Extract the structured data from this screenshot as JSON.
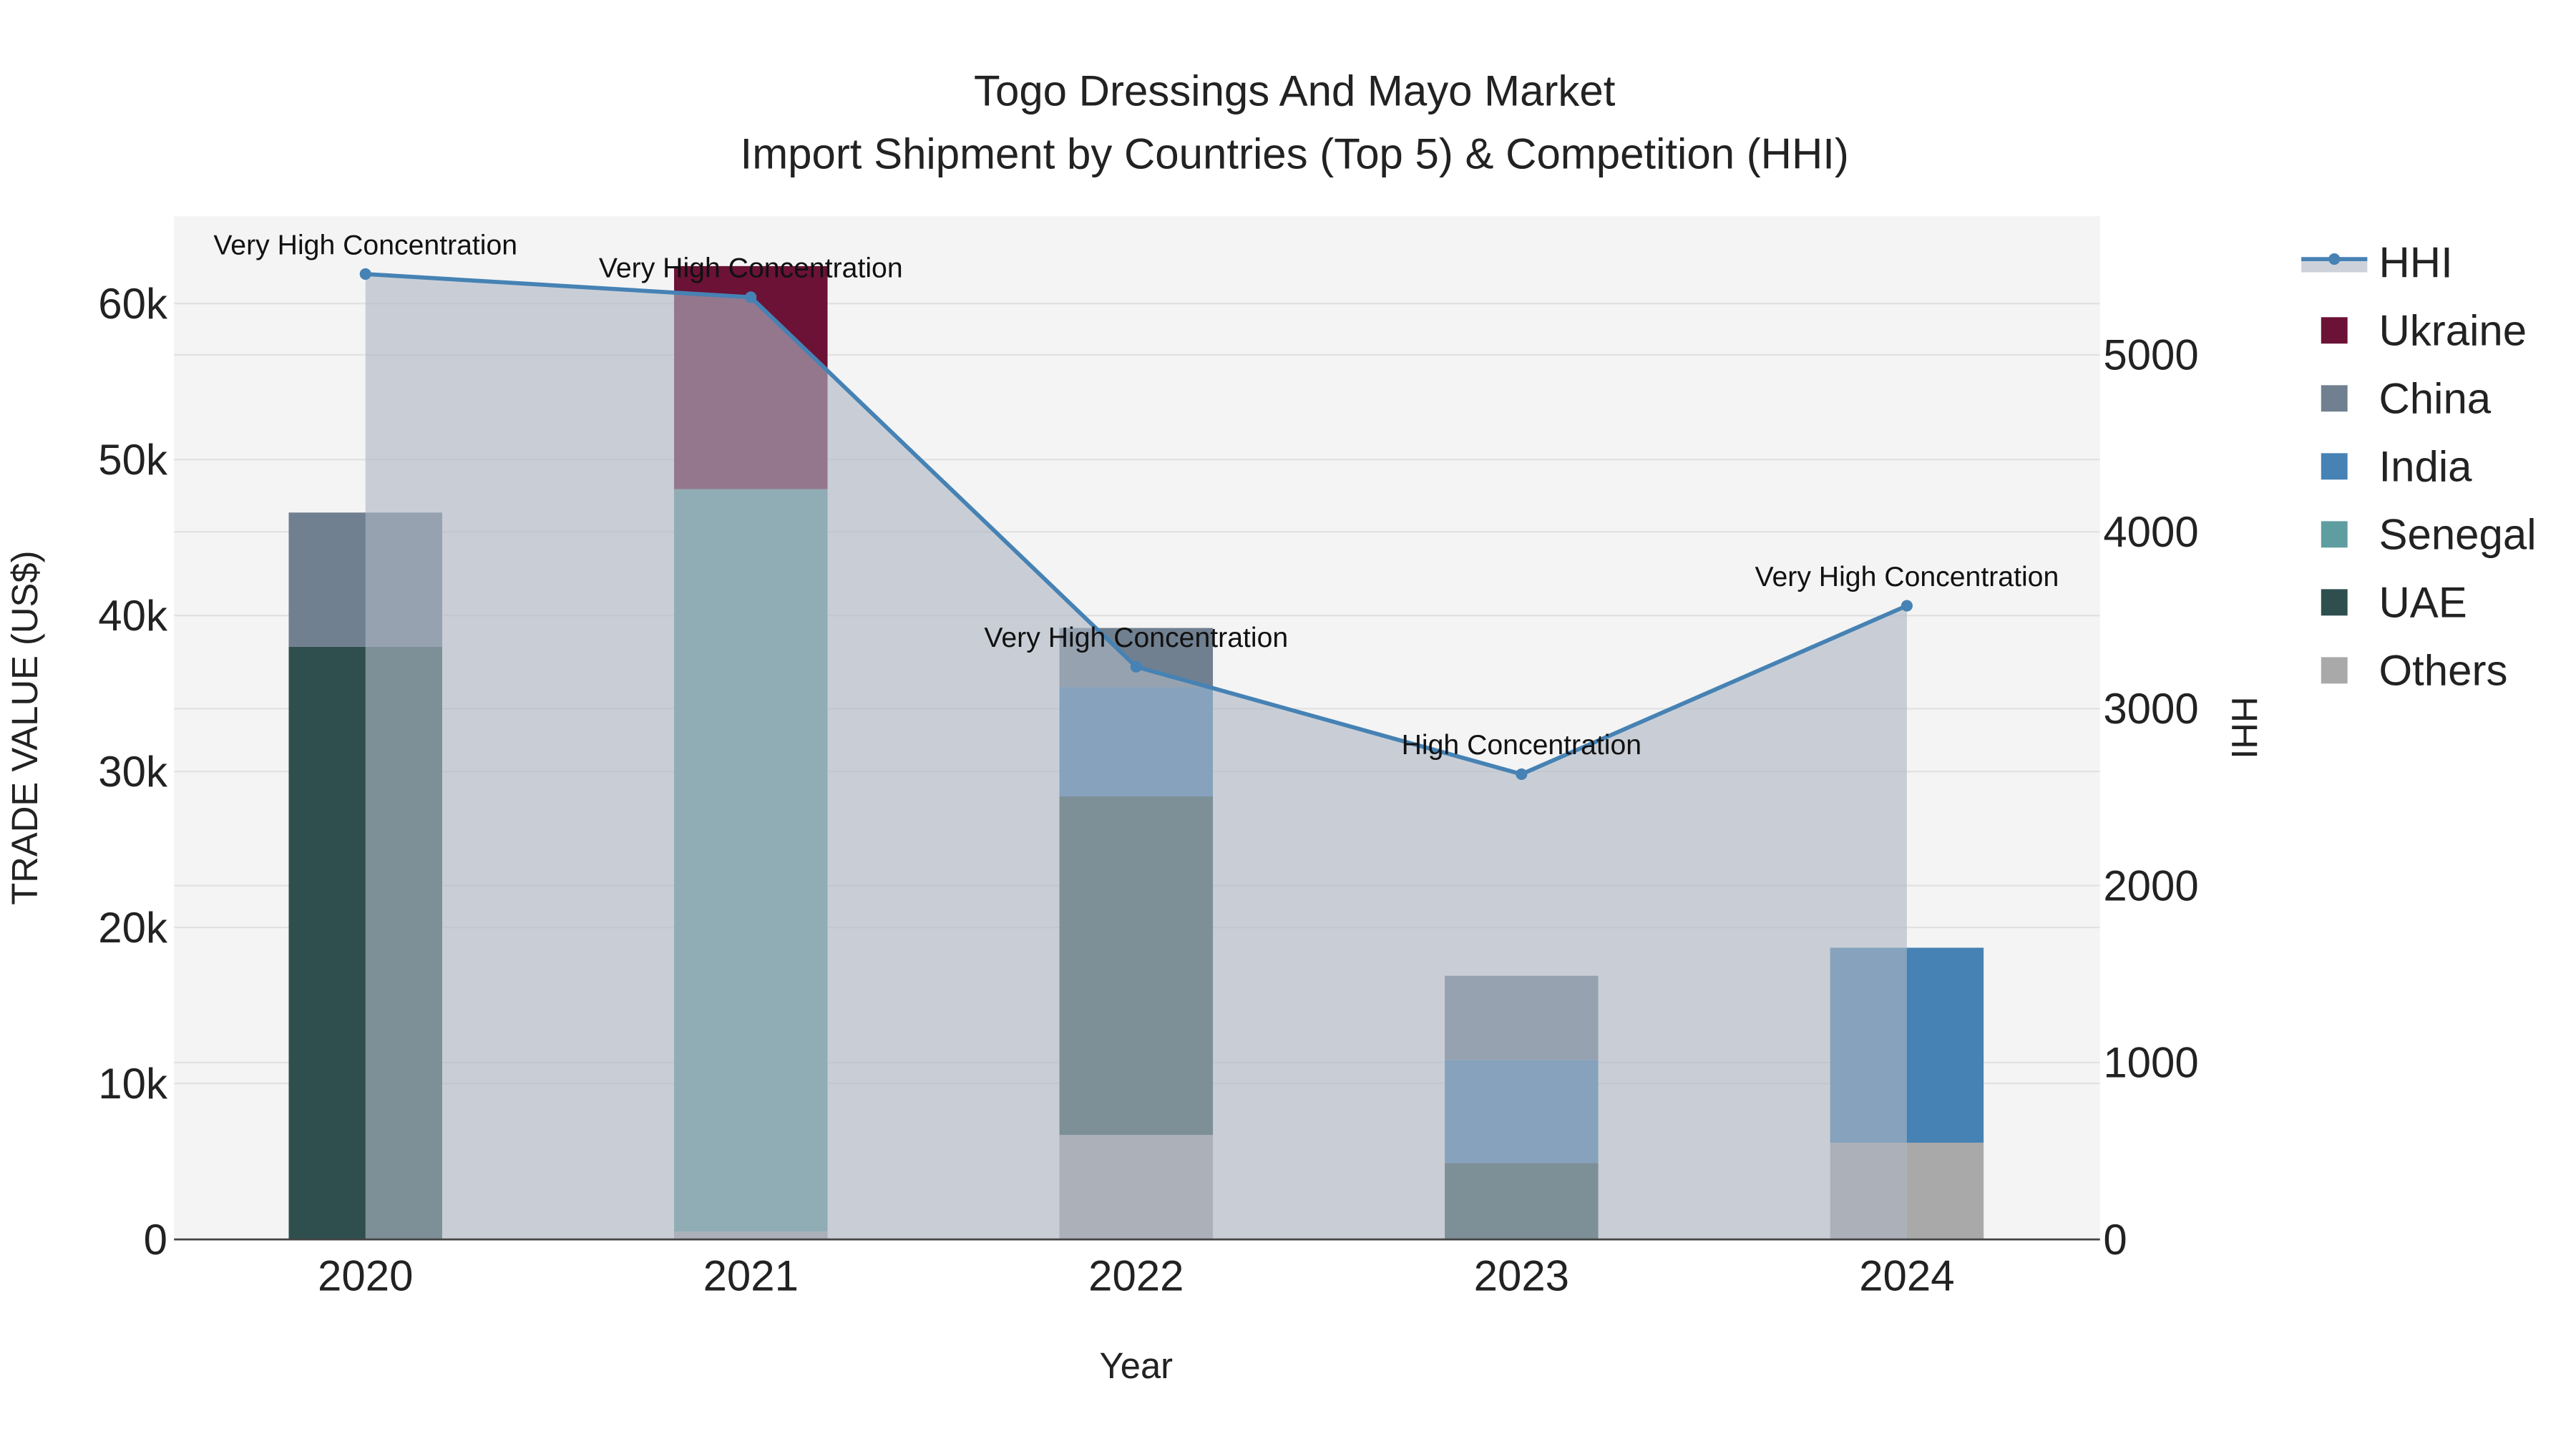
{
  "chart_data": {
    "type": "bar",
    "title_line1": "Togo Dressings And Mayo Market",
    "title_line2": "Import Shipment by Countries (Top 5) & Competition (HHI)",
    "xlabel": "Year",
    "ylabel": "TRADE VALUE (US$)",
    "y2label": "HHI",
    "categories": [
      "2020",
      "2021",
      "2022",
      "2023",
      "2024"
    ],
    "ylim": [
      0,
      65600
    ],
    "y2lim": [
      0,
      5784
    ],
    "yticks": [
      0,
      10000,
      20000,
      30000,
      40000,
      50000,
      60000
    ],
    "ytick_labels": [
      "0",
      "10k",
      "20k",
      "30k",
      "40k",
      "50k",
      "60k"
    ],
    "y2ticks": [
      0,
      1000,
      2000,
      3000,
      4000,
      5000
    ],
    "y2tick_labels": [
      "0",
      "1000",
      "2000",
      "3000",
      "4000",
      "5000"
    ],
    "stack_order": [
      "Others",
      "UAE",
      "Senegal",
      "India",
      "China",
      "Ukraine"
    ],
    "series": [
      {
        "name": "Ukraine",
        "color": "#6b1236",
        "values": [
          0,
          14300,
          0,
          0,
          0
        ]
      },
      {
        "name": "China",
        "color": "#708090",
        "values": [
          8600,
          0,
          3800,
          5400,
          0
        ]
      },
      {
        "name": "India",
        "color": "#4682b4",
        "values": [
          0,
          0,
          7000,
          6600,
          12500
        ]
      },
      {
        "name": "Senegal",
        "color": "#5f9ea0",
        "values": [
          0,
          47600,
          0,
          0,
          0
        ]
      },
      {
        "name": "UAE",
        "color": "#2f4f4f",
        "values": [
          38000,
          0,
          21700,
          4900,
          0
        ]
      },
      {
        "name": "Others",
        "color": "#a9a9a9",
        "values": [
          0,
          500,
          6700,
          0,
          6200
        ]
      }
    ],
    "hhi": {
      "name": "HHI",
      "color": "#4682b4",
      "values": [
        5457,
        5326,
        3237,
        2630,
        3582
      ],
      "annotations": [
        "Very High Concentration",
        "Very High Concentration",
        "Very High Concentration",
        "High Concentration",
        "Very High Concentration"
      ]
    },
    "legend_position": "right",
    "legend": [
      "HHI",
      "Ukraine",
      "China",
      "India",
      "Senegal",
      "UAE",
      "Others"
    ],
    "grid": true
  }
}
